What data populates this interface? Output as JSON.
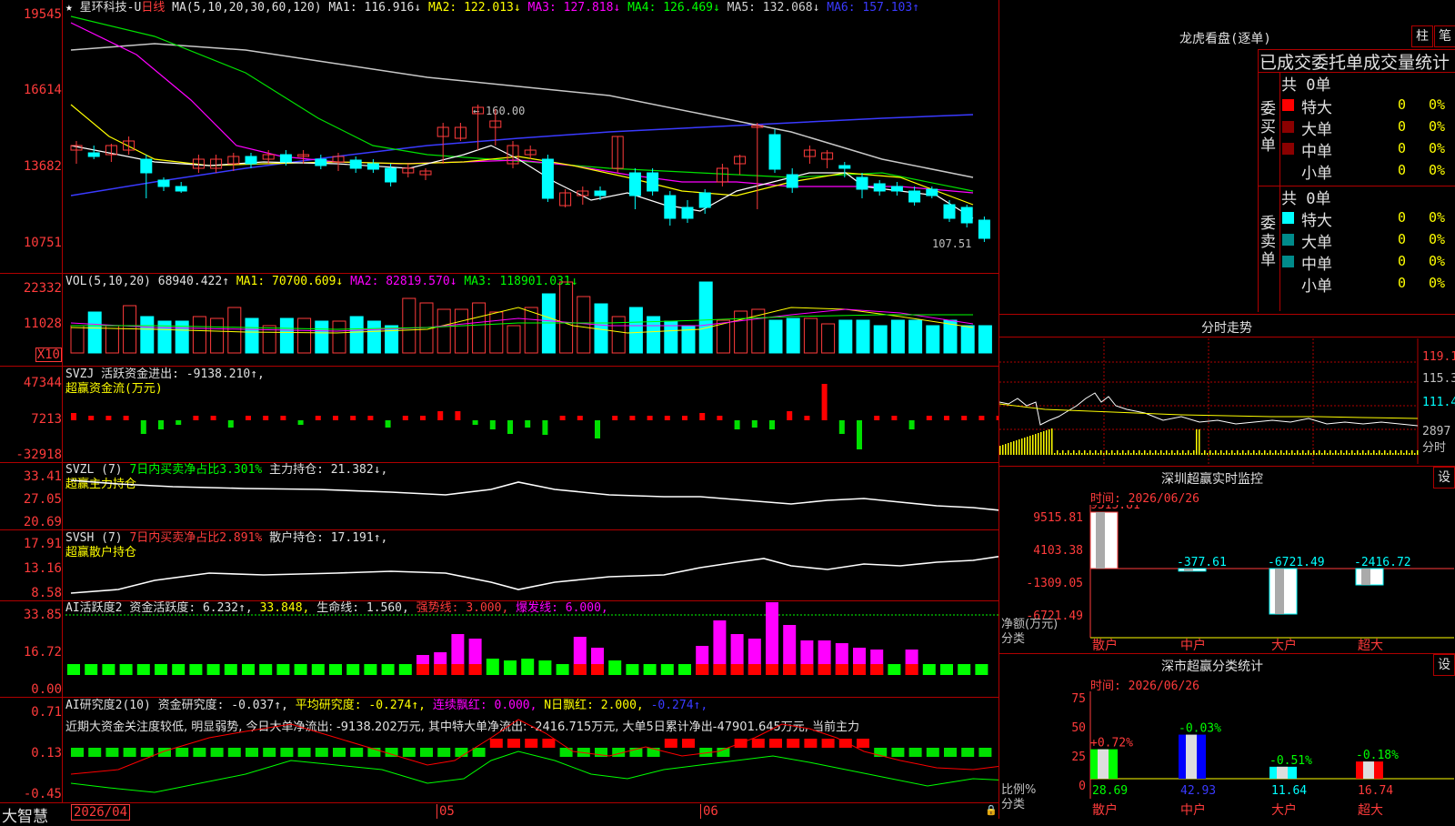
{
  "main_header": {
    "star": "★",
    "stock_name": "星环科技-U",
    "period": "日线",
    "ma_label": "MA(5,10,20,30,60,120)",
    "ma1": "MA1: 116.916↓",
    "ma2": "MA2: 122.013↓",
    "ma3": "MA3: 127.818↓",
    "ma4": "MA4: 126.469↓",
    "ma5": "MA5: 132.068↓",
    "ma6": "MA6: 157.103↑"
  },
  "price_axis": [
    "19545",
    "16614",
    "13682",
    "10751"
  ],
  "price_annot": {
    "high": "160.00",
    "low": "107.51"
  },
  "vol_header": {
    "label": "VOL(5,10,20)",
    "vol": "68940.422↑",
    "ma1": "MA1: 70700.609↓",
    "ma2": "MA2: 82819.570↓",
    "ma3": "MA3: 118901.031↓"
  },
  "vol_axis": [
    "22332",
    "11028",
    "X10"
  ],
  "svzj_header": {
    "label": "SVZJ",
    "text": "活跃资金进出: -9138.210↑,",
    "sub": "超赢资金流(万元)"
  },
  "svzj_axis": [
    "47344",
    "7213",
    "-32918"
  ],
  "svzl_header": {
    "label": "SVZL (7)",
    "ratio": "7日内买卖净占比3.301%",
    "hold": "主力持仓: 21.382↓,",
    "sub": "超赢主力持仓"
  },
  "svzl_axis": [
    "33.41",
    "27.05",
    "20.69"
  ],
  "svsh_header": {
    "label": "SVSH (7)",
    "ratio": "7日内买卖净占比2.891%",
    "hold": "散户持仓: 17.191↑,",
    "sub": "超赢散户持仓"
  },
  "svsh_axis": [
    "17.91",
    "13.16",
    "8.58"
  ],
  "ai_header": {
    "label": "AI活跃度2",
    "a": "资金活跃度: 6.232↑,",
    "b": "33.848,",
    "c": "生命线: 1.560,",
    "d": "强势线: 3.000,",
    "e": "爆发线: 6.000,"
  },
  "ai_axis": [
    "33.85",
    "16.72",
    "0.00"
  ],
  "air_header": {
    "label": "AI研究度2(10)",
    "a": "资金研究度: -0.037↑,",
    "b": "平均研究度: -0.274↑,",
    "c": "连续飘红: 0.000,",
    "d": "N日飘红: 2.000,",
    "e": "-0.274↑,"
  },
  "air_text": "近期大资金关注度较低, 明显弱势, 今日大单净流出: -9138.202万元, 其中特大单净流出: -2416.715万元, 大单5日累计净出-47901.645万元, 当前主力",
  "air_axis": [
    "0.71",
    "0.13",
    "-0.45"
  ],
  "bottom": {
    "brand": "大智慧",
    "date": "2026/04",
    "m05": "05",
    "m06": "06"
  },
  "dragon": {
    "title": "龙虎看盘(逐单)",
    "tab1": "柱",
    "tab2": "笔",
    "subtitle": "已成交委托单成交量统计",
    "buy_label": "委买单",
    "sell_label": "委卖单",
    "buy_total": "共 0单",
    "sell_total": "共 0单",
    "buy_rows": [
      {
        "name": "特大",
        "count": "0",
        "pct": "0%"
      },
      {
        "name": "大单",
        "count": "0",
        "pct": "0%"
      },
      {
        "name": "中单",
        "count": "0",
        "pct": "0%"
      },
      {
        "name": "小单",
        "count": "0",
        "pct": "0%"
      }
    ],
    "sell_rows": [
      {
        "name": "特大",
        "count": "0",
        "pct": "0%"
      },
      {
        "name": "大单",
        "count": "0",
        "pct": "0%"
      },
      {
        "name": "中单",
        "count": "0",
        "pct": "0%"
      },
      {
        "name": "小单",
        "count": "0",
        "pct": "0%"
      }
    ],
    "buy_colors": [
      "#ff0000",
      "#8b0000",
      "#8b0000",
      "#000000"
    ],
    "sell_colors": [
      "#00ffff",
      "#008b8b",
      "#008b8b",
      "#000000"
    ]
  },
  "intraday": {
    "title": "分时走势",
    "axis": [
      "119.1",
      "115.3",
      "111.4",
      "2897",
      "分时"
    ]
  },
  "sz_monitor": {
    "title": "深圳超赢实时监控",
    "set": "设",
    "time": "时间: 2026/06/26",
    "axis": [
      "9515.81",
      "4103.38",
      "-1309.05",
      "-6721.49"
    ],
    "ylab1": "净额(万元)",
    "ylab2": "分类",
    "categories": [
      "散户",
      "中户",
      "大户",
      "超大"
    ],
    "values": [
      9515.81,
      -377.61,
      -6721.49,
      -2416.72
    ],
    "labels": [
      "9515.81",
      "-377.61",
      "-6721.49",
      "-2416.72"
    ]
  },
  "sz_class": {
    "title": "深市超赢分类统计",
    "set": "设",
    "time": "时间: 2026/06/26",
    "axis": [
      "75",
      "50",
      "25",
      "0"
    ],
    "ylab1": "比例%",
    "ylab2": "分类",
    "categories": [
      "散户",
      "中户",
      "大户",
      "超大"
    ],
    "values": [
      28.69,
      42.93,
      11.64,
      16.74
    ],
    "labels": [
      "28.69",
      "42.93",
      "11.64",
      "16.74"
    ],
    "changes": [
      "+0.72%",
      "-0.03%",
      "-0.51%",
      "-0.18%"
    ]
  },
  "colors": {
    "up": "#ff3b3b",
    "down": "#00ffff",
    "grid": "#b00000",
    "magenta": "#ff00ff",
    "green": "#00ff00",
    "yellow": "#ffff00"
  }
}
